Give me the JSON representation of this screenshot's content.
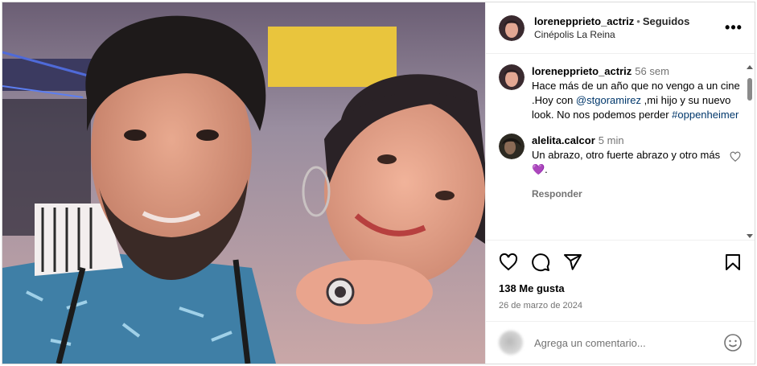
{
  "post": {
    "author": "lorenepprieto_actriz",
    "separator": "•",
    "follow_status": "Seguidos",
    "location": "Cinépolis La Reina",
    "more_label": "•••"
  },
  "caption": {
    "user": "lorenepprieto_actriz",
    "time": "56 sem",
    "text_before": "Hace más de un año que no vengo a un cine .Hoy con ",
    "mention": "@stgoramirez",
    "text_after": " ,mi hijo y su nuevo look. No nos podemos perder ",
    "hashtag": "#oppenheimer"
  },
  "comments": [
    {
      "user": "alelita.calcor",
      "time": "5 min",
      "text": "Un abrazo, otro fuerte abrazo y otro más💜.",
      "reply_label": "Responder"
    }
  ],
  "engagement": {
    "likes": "138 Me gusta",
    "date": "26 de marzo de 2024"
  },
  "composer": {
    "placeholder": "Agrega un comentario..."
  },
  "icons": [
    "heart-icon",
    "comment-icon",
    "share-icon",
    "bookmark-icon",
    "emoji-icon",
    "more-icon"
  ],
  "colors": {
    "link": "#00376b",
    "secondary_text": "#737373",
    "border": "#dbdbdb"
  }
}
